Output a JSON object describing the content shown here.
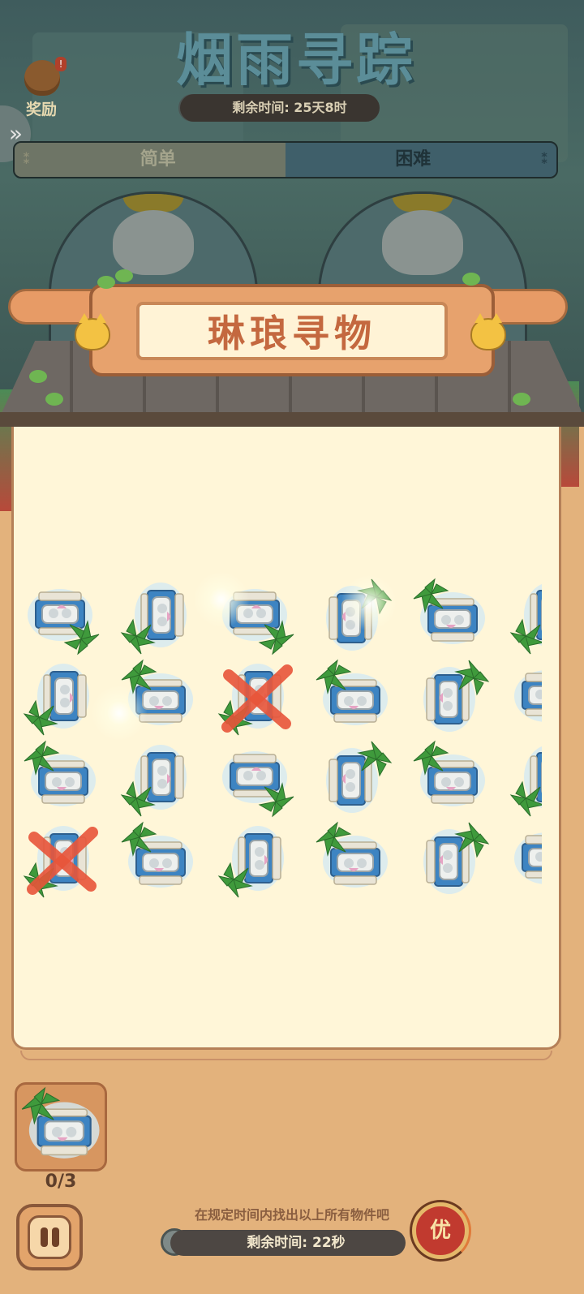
{
  "header": {
    "title": "烟雨寻踪",
    "reward_label": "奖励",
    "time_remaining": "剩余时间: 25天8时"
  },
  "difficulty_tabs": [
    {
      "label": "简单",
      "selected": false
    },
    {
      "label": "困难",
      "selected": true
    }
  ],
  "board": {
    "sign_title": "琳琅寻物"
  },
  "target": {
    "count": "0/3"
  },
  "footer": {
    "hint": "在规定时间内找出以上所有物件吧",
    "time_remaining": "剩余时间: 22秒",
    "priority_label": "优"
  },
  "colors": {
    "paper": "#fff6d8",
    "frame": "#e3b27c",
    "sign_text": "#c4683f",
    "cross": "#e8553a"
  },
  "icons": [
    "clock-icon",
    "reward-bag-icon",
    "pause-icon",
    "chevron-right-icon"
  ]
}
